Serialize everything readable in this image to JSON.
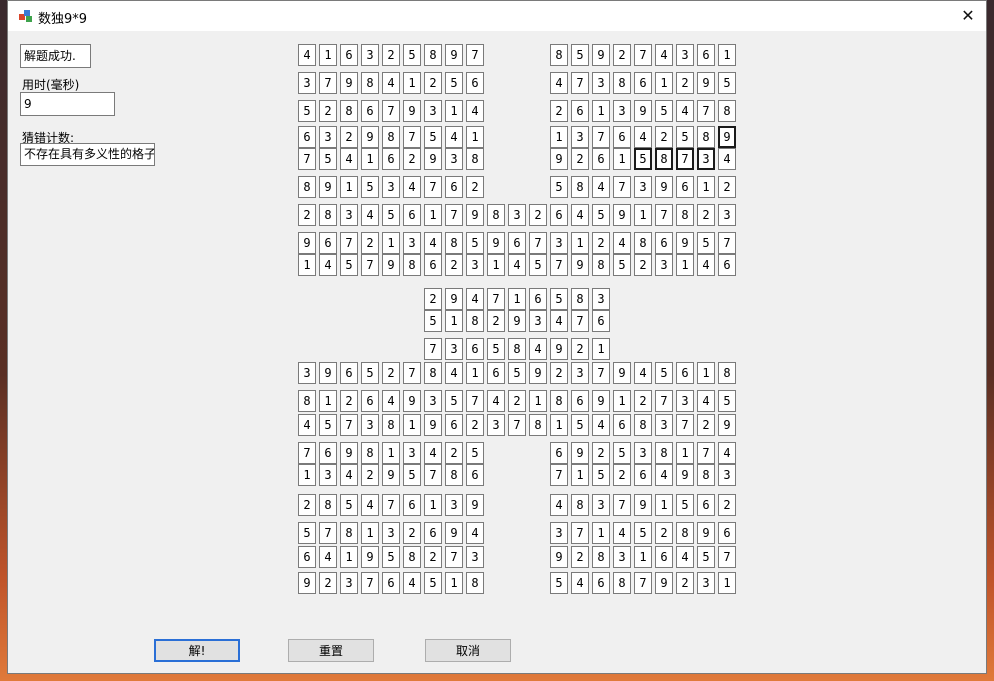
{
  "window": {
    "title": "数独9*9",
    "close_glyph": "✕"
  },
  "status_box": {
    "text": "解题成功."
  },
  "time": {
    "label": "用时(毫秒)",
    "value": "9"
  },
  "guess": {
    "label": "猜错计数:",
    "value": "不存在具有多义性的格子"
  },
  "buttons": {
    "solve": "解!",
    "reset": "重置",
    "cancel": "取消"
  },
  "grid": {
    "cols": [
      1,
      1,
      1,
      1,
      1,
      1,
      1,
      1,
      1,
      1,
      1,
      1,
      1,
      1,
      1,
      1,
      1,
      1,
      1,
      1,
      1,
      1,
      1
    ],
    "rows": [
      {
        "c": 1,
        "v": "416325897"
      },
      {
        "c": 13,
        "v": "859274361"
      },
      {
        "c": 1,
        "v": "379841256"
      },
      {
        "c": 13,
        "v": "473861295"
      },
      {
        "c": 1,
        "v": "528679314"
      },
      {
        "c": 13,
        "v": "261395478"
      },
      {
        "c": 1,
        "v": "632987541"
      },
      {
        "c": 13,
        "v": "137642589"
      },
      {
        "c": 1,
        "v": "754162938"
      },
      {
        "c": 13,
        "v": "926158734"
      },
      {
        "c": 1,
        "v": "891534762"
      },
      {
        "c": 13,
        "v": "584739612"
      },
      {
        "c": 1,
        "v": "283456179832645917823"
      },
      {
        "c": 1,
        "v": "967213485967312486957"
      },
      {
        "c": 1,
        "v": "145798623145798523146"
      },
      {
        "c": 7,
        "v": "294716583"
      },
      {
        "c": 7,
        "v": "518293476"
      },
      {
        "c": 7,
        "v": "736584921"
      },
      {
        "c": 1,
        "v": "396527841659237945618"
      },
      {
        "c": 1,
        "v": "812649357421869127345"
      },
      {
        "c": 1,
        "v": "457381962378154683729"
      },
      {
        "c": 1,
        "v": "769813425"
      },
      {
        "c": 13,
        "v": "692538174"
      },
      {
        "c": 1,
        "v": "134295786"
      },
      {
        "c": 13,
        "v": "715264983"
      },
      {
        "c": 1,
        "v": "285476139"
      },
      {
        "c": 13,
        "v": "483791562"
      },
      {
        "c": 1,
        "v": "578132694"
      },
      {
        "c": 13,
        "v": "371452896"
      },
      {
        "c": 1,
        "v": "641958273"
      },
      {
        "c": 13,
        "v": "928316457"
      },
      {
        "c": 1,
        "v": "923764518"
      },
      {
        "c": 13,
        "v": "546879231"
      }
    ]
  }
}
